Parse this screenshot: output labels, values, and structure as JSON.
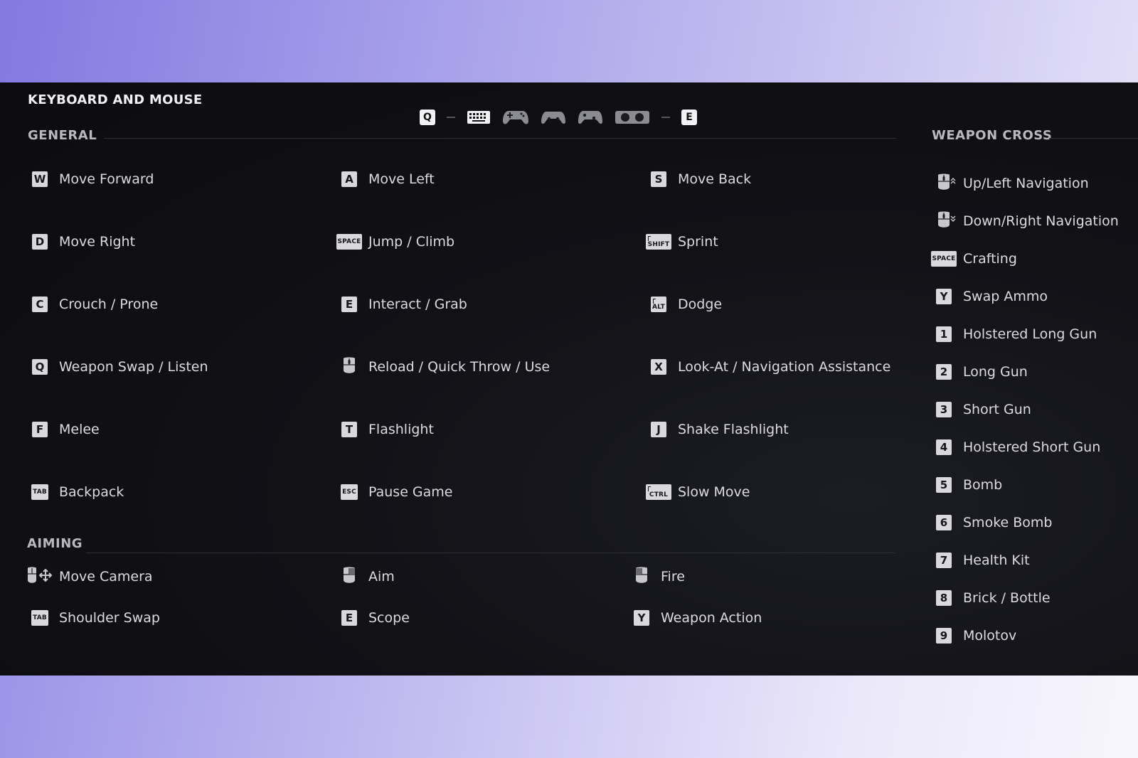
{
  "panel": {
    "title": "KEYBOARD AND MOUSE"
  },
  "device_bar": {
    "prev_key": "Q",
    "next_key": "E",
    "devices": [
      "keyboard-icon",
      "gamepad-icon",
      "dualshock-icon",
      "xbox-controller-icon",
      "joycon-icon"
    ]
  },
  "sections": {
    "general": "GENERAL",
    "aiming": "AIMING",
    "weapon_cross": "WEAPON CROSS"
  },
  "general": [
    {
      "key": "W",
      "label": "Move Forward"
    },
    {
      "key": "A",
      "label": "Move Left"
    },
    {
      "key": "S",
      "label": "Move Back"
    },
    {
      "key": "D",
      "label": "Move Right"
    },
    {
      "key": "SPACE",
      "label": "Jump / Climb"
    },
    {
      "key": "SHIFT",
      "label": "Sprint"
    },
    {
      "key": "C",
      "label": "Crouch / Prone"
    },
    {
      "key": "E",
      "label": "Interact / Grab"
    },
    {
      "key": "ALT",
      "label": "Dodge"
    },
    {
      "key": "Q",
      "label": "Weapon Swap / Listen"
    },
    {
      "key": "mouse-middle-click-icon",
      "label": "Reload / Quick Throw / Use"
    },
    {
      "key": "X",
      "label": "Look-At / Navigation Assistance"
    },
    {
      "key": "F",
      "label": "Melee"
    },
    {
      "key": "T",
      "label": "Flashlight"
    },
    {
      "key": "J",
      "label": "Shake Flashlight"
    },
    {
      "key": "TAB",
      "label": "Backpack"
    },
    {
      "key": "ESC",
      "label": "Pause Game"
    },
    {
      "key": "CTRL",
      "label": "Slow Move"
    }
  ],
  "aiming": [
    {
      "key": "mouse-move-icon",
      "label": "Move Camera"
    },
    {
      "key": "mouse-right-click-icon",
      "label": "Aim"
    },
    {
      "key": "mouse-left-click-icon",
      "label": "Fire"
    },
    {
      "key": "TAB",
      "label": "Shoulder Swap"
    },
    {
      "key": "E",
      "label": "Scope"
    },
    {
      "key": "Y",
      "label": "Weapon Action"
    }
  ],
  "weapon_cross": [
    {
      "key": "mouse-scroll-up-icon",
      "label": "Up/Left Navigation"
    },
    {
      "key": "mouse-scroll-down-icon",
      "label": "Down/Right Navigation"
    },
    {
      "key": "SPACE",
      "label": "Crafting"
    },
    {
      "key": "Y",
      "label": "Swap Ammo"
    },
    {
      "key": "1",
      "label": "Holstered Long Gun"
    },
    {
      "key": "2",
      "label": "Long Gun"
    },
    {
      "key": "3",
      "label": "Short Gun"
    },
    {
      "key": "4",
      "label": "Holstered Short Gun"
    },
    {
      "key": "5",
      "label": "Bomb"
    },
    {
      "key": "6",
      "label": "Smoke Bomb"
    },
    {
      "key": "7",
      "label": "Health Kit"
    },
    {
      "key": "8",
      "label": "Brick / Bottle"
    },
    {
      "key": "9",
      "label": "Molotov"
    }
  ]
}
